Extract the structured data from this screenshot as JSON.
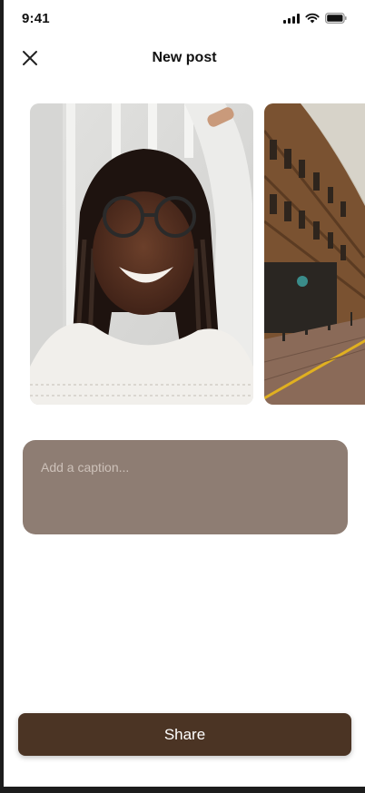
{
  "status_bar": {
    "time": "9:41",
    "icons": [
      "signal-icon",
      "wifi-icon",
      "battery-icon"
    ]
  },
  "header": {
    "title": "New post",
    "close_icon": "close-icon"
  },
  "photos": [
    {
      "name": "portrait-photo"
    },
    {
      "name": "street-building-photo"
    }
  ],
  "caption": {
    "placeholder": "Add a caption..."
  },
  "share_button": {
    "label": "Share"
  },
  "colors": {
    "caption_bg": "#8e7d73",
    "share_bg": "#4b3424"
  }
}
